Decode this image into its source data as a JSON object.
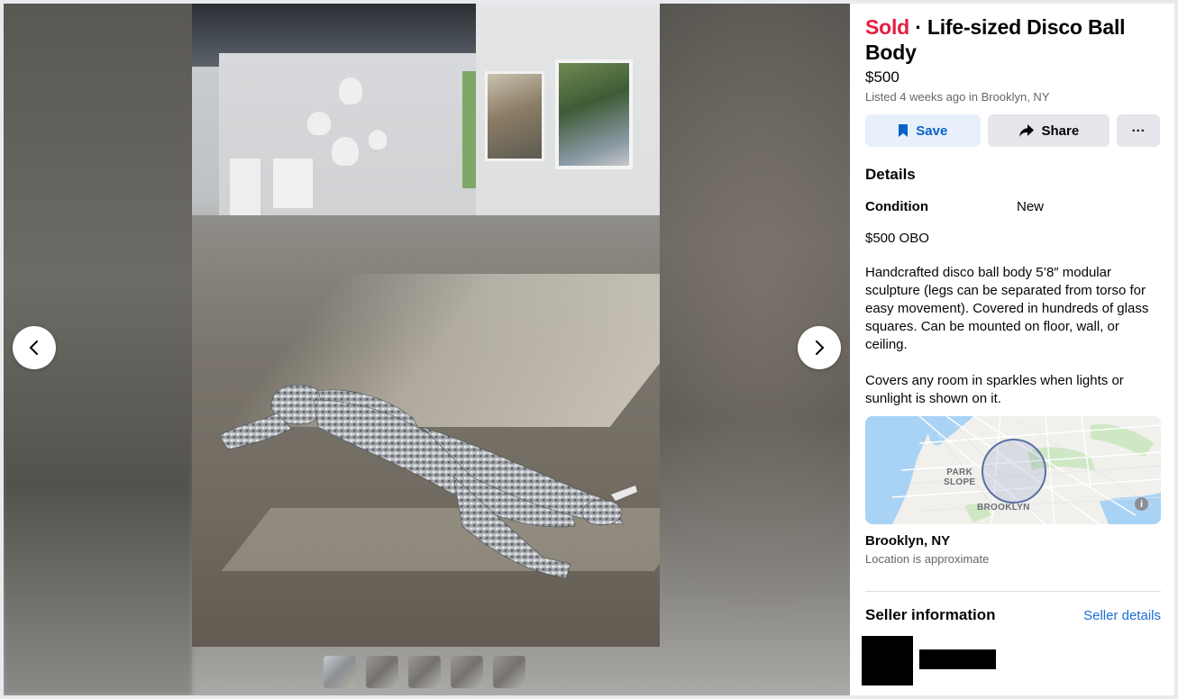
{
  "viewer": {
    "prev_icon": "chevron-left-icon",
    "next_icon": "chevron-right-icon",
    "thumbnail_count": 5,
    "active_thumbnail": 1
  },
  "listing": {
    "status": "Sold",
    "separator": " · ",
    "title": "Life-sized Disco Ball Body",
    "price": "$500",
    "listed_text": "Listed 4 weeks ago in Brooklyn, NY"
  },
  "actions": {
    "save_label": "Save",
    "save_icon": "bookmark-icon",
    "share_label": "Share",
    "share_icon": "share-arrow-icon",
    "more_label": "···",
    "more_icon": "more-horizontal-icon"
  },
  "details": {
    "heading": "Details",
    "condition_label": "Condition",
    "condition_value": "New",
    "price_note": "$500 OBO",
    "description_1": "Handcrafted disco ball body 5’8″ modular sculpture (legs can be separated from torso for easy movement). Covered in hundreds of glass squares. Can be mounted on floor, wall, or ceiling.",
    "description_2": "Covers any room in sparkles when lights or sunlight is shown on it."
  },
  "map": {
    "label_park_slope_1": "PARK",
    "label_park_slope_2": "SLOPE",
    "label_brooklyn": "BROOKLYN",
    "info_icon": "info-icon",
    "info_glyph": "i"
  },
  "location": {
    "name": "Brooklyn, NY",
    "note": "Location is approximate"
  },
  "seller": {
    "heading": "Seller information",
    "details_link": "Seller details"
  },
  "colors": {
    "sold_red": "#e41e3f",
    "link_blue": "#1d6ed6",
    "save_bg": "#e7f0fb"
  }
}
